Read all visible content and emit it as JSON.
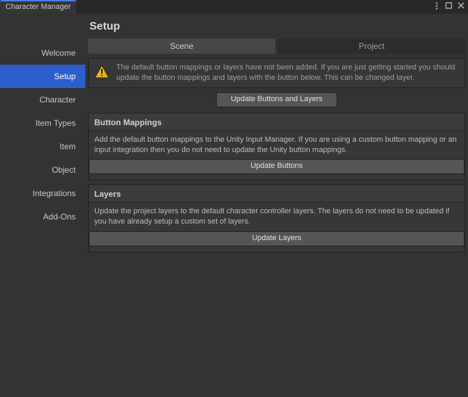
{
  "window": {
    "title": "Character Manager"
  },
  "page": {
    "title": "Setup"
  },
  "sidebar": {
    "items": [
      {
        "label": "Welcome"
      },
      {
        "label": "Setup"
      },
      {
        "label": "Character"
      },
      {
        "label": "Item Types"
      },
      {
        "label": "Item"
      },
      {
        "label": "Object"
      },
      {
        "label": "Integrations"
      },
      {
        "label": "Add-Ons"
      }
    ],
    "selected_index": 1
  },
  "subtabs": {
    "items": [
      {
        "label": "Scene"
      },
      {
        "label": "Project"
      }
    ],
    "active_index": 0
  },
  "warning": {
    "text": "The default button mappings or layers have not been added. If you are just getting started you should update the button mappings and layers with the button below. This can be changed layer.",
    "button_label": "Update Buttons and Layers"
  },
  "sections": [
    {
      "title": "Button Mappings",
      "body": "Add the default button mappings to the Unity Input Manager. If you are using a custom button mapping or an input integration then you do not need to update the Unity button mappings.",
      "button_label": "Update Buttons"
    },
    {
      "title": "Layers",
      "body": "Update the project layers to the default character controller layers. The layers do not need to be updated if you have already setup a custom set of layers.",
      "button_label": "Update Layers"
    }
  ]
}
